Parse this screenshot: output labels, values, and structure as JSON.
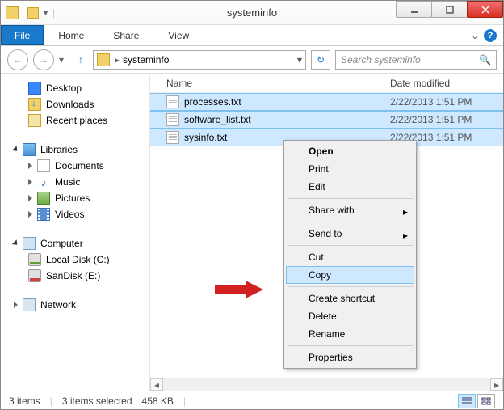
{
  "window": {
    "title": "systeminfo"
  },
  "ribbon": {
    "file": "File",
    "tabs": [
      "Home",
      "Share",
      "View"
    ]
  },
  "address": {
    "path": "systeminfo"
  },
  "search": {
    "placeholder": "Search systeminfo"
  },
  "navpane": {
    "favorites": [
      {
        "label": "Desktop",
        "icon": "desktop"
      },
      {
        "label": "Downloads",
        "icon": "downloads"
      },
      {
        "label": "Recent places",
        "icon": "recent"
      }
    ],
    "libraries_label": "Libraries",
    "libraries": [
      {
        "label": "Documents",
        "icon": "doc"
      },
      {
        "label": "Music",
        "icon": "music"
      },
      {
        "label": "Pictures",
        "icon": "pictures"
      },
      {
        "label": "Videos",
        "icon": "videos"
      }
    ],
    "computer_label": "Computer",
    "drives": [
      {
        "label": "Local Disk (C:)",
        "icon": "disk"
      },
      {
        "label": "SanDisk (E:)",
        "icon": "sandisk"
      }
    ],
    "network_label": "Network"
  },
  "list": {
    "columns": {
      "name": "Name",
      "date": "Date modified"
    },
    "rows": [
      {
        "name": "processes.txt",
        "date": "2/22/2013 1:51 PM"
      },
      {
        "name": "software_list.txt",
        "date": "2/22/2013 1:51 PM"
      },
      {
        "name": "sysinfo.txt",
        "date": "2/22/2013 1:51 PM"
      }
    ]
  },
  "context_menu": {
    "open": "Open",
    "print": "Print",
    "edit": "Edit",
    "share_with": "Share with",
    "send_to": "Send to",
    "cut": "Cut",
    "copy": "Copy",
    "create_shortcut": "Create shortcut",
    "delete": "Delete",
    "rename": "Rename",
    "properties": "Properties"
  },
  "status": {
    "count": "3 items",
    "selected": "3 items selected",
    "size": "458 KB"
  }
}
